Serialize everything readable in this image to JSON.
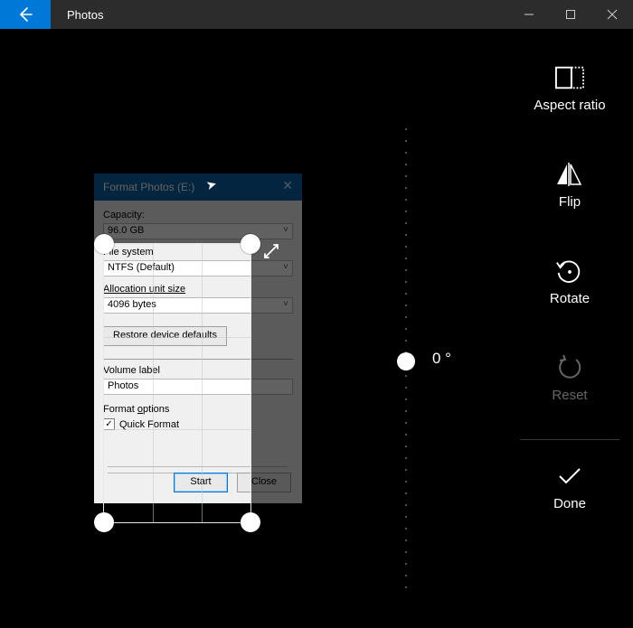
{
  "window": {
    "app_title": "Photos"
  },
  "tools": {
    "aspect_ratio": "Aspect ratio",
    "flip": "Flip",
    "rotate": "Rotate",
    "reset": "Reset",
    "done": "Done"
  },
  "rotation": {
    "value_label": "0 °"
  },
  "format_dialog": {
    "title": "Format Photos (E:)",
    "capacity_label": "Capacity:",
    "capacity_value": "96.0 GB",
    "filesystem_label": "File system",
    "filesystem_value": "NTFS (Default)",
    "alloc_label": "Allocation unit size",
    "alloc_value": "4096 bytes",
    "restore_defaults": "Restore device defaults",
    "volume_label_label": "Volume label",
    "volume_label_value": "Photos",
    "format_options_label": "Format options",
    "quick_format_label": "Quick Format",
    "quick_format_checked": true,
    "start_btn": "Start",
    "close_btn": "Close"
  }
}
